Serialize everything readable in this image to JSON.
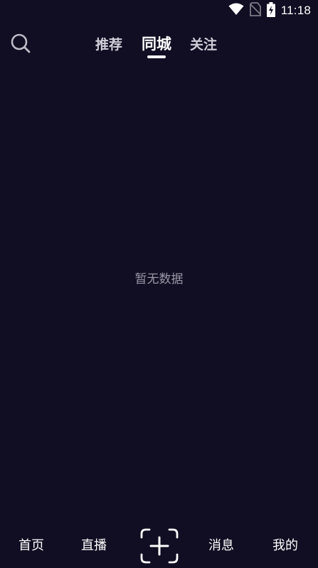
{
  "status_bar": {
    "time": "11:18",
    "icons": [
      "wifi-icon",
      "no-sim-icon",
      "battery-charging-icon"
    ]
  },
  "top_bar": {
    "search_icon": "search-icon",
    "tabs": [
      {
        "label": "推荐",
        "active": false
      },
      {
        "label": "同城",
        "active": true
      },
      {
        "label": "关注",
        "active": false
      }
    ]
  },
  "content": {
    "empty_message": "暂无数据"
  },
  "bottom_nav": {
    "items": [
      {
        "label": "首页"
      },
      {
        "label": "直播"
      },
      {
        "label": "消息"
      },
      {
        "label": "我的"
      }
    ],
    "publish_icon": "add-icon"
  },
  "colors": {
    "background": "#110d22",
    "tab_inactive": "#d0ced8",
    "empty_text": "#9a97a6",
    "foreground": "#ffffff"
  }
}
